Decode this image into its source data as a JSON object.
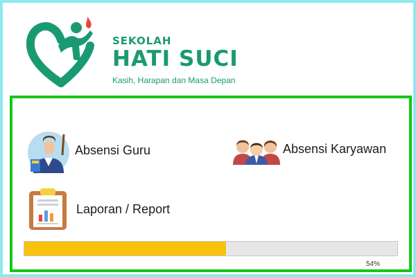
{
  "header": {
    "kicker": "SEKOLAH",
    "school_name": "HATI SUCI",
    "tagline": "Kasih, Harapan dan Masa Depan"
  },
  "menu": {
    "absensi_guru": {
      "label": "Absensi Guru",
      "icon": "teacher-icon"
    },
    "absensi_karyawan": {
      "label": "Absensi Karyawan",
      "icon": "employees-icon"
    },
    "laporan": {
      "label": "Laporan / Report",
      "icon": "report-clipboard-icon"
    }
  },
  "progress": {
    "value_percent": 54,
    "text": "54%"
  },
  "colors": {
    "frame_border": "#8ee8ef",
    "panel_border": "#16c616",
    "brand_green": "#1a9a72",
    "progress_fill": "#fac10a",
    "progress_track": "#e6e6e6"
  }
}
